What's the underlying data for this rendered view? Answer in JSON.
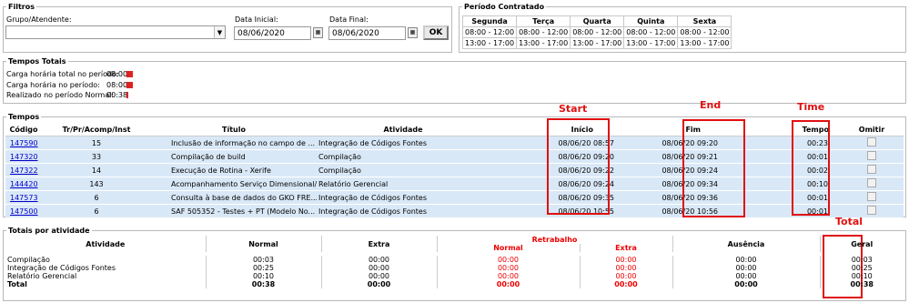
{
  "filtros": {
    "legend": "Filtros",
    "grupo_label": "Grupo/Atendente:",
    "grupo_value": "",
    "data_inicial_label": "Data Inicial:",
    "data_inicial_value": "08/06/2020",
    "data_final_label": "Data Final:",
    "data_final_value": "08/06/2020",
    "ok_label": "OK"
  },
  "periodo": {
    "legend": "Período Contratado",
    "days": [
      "Segunda",
      "Terça",
      "Quarta",
      "Quinta",
      "Sexta"
    ],
    "row1": "08:00 - 12:00",
    "row2": "13:00 - 17:00"
  },
  "tempos_totais": {
    "legend": "Tempos Totais",
    "items": [
      {
        "label": "Carga horária total no período:",
        "value": "08:00"
      },
      {
        "label": "Carga horária no período:",
        "value": "08:00"
      },
      {
        "label": "Realizado no período Normal:",
        "value": "00:38"
      }
    ]
  },
  "tempos": {
    "legend": "Tempos",
    "columns": [
      "Código",
      "Tr/Pr/Acomp/Inst",
      "Título",
      "Atividade",
      "Início",
      "Fim",
      "Tempo",
      "Omitir"
    ],
    "rows": [
      {
        "codigo": "147590",
        "tr": "15",
        "titulo": "Inclusão de informação no campo de ...",
        "atividade": "Integração de Códigos Fontes",
        "inicio": "08/06/20 08:57",
        "fim": "08/06/20 09:20",
        "tempo": "00:23"
      },
      {
        "codigo": "147320",
        "tr": "33",
        "titulo": "Compilação de build",
        "atividade": "Compilação",
        "inicio": "08/06/20 09:20",
        "fim": "08/06/20 09:21",
        "tempo": "00:01"
      },
      {
        "codigo": "147322",
        "tr": "14",
        "titulo": "Execução de Rotina - Xerife",
        "atividade": "Compilação",
        "inicio": "08/06/20 09:22",
        "fim": "08/06/20 09:24",
        "tempo": "00:02"
      },
      {
        "codigo": "144420",
        "tr": "143",
        "titulo": "Acompanhamento Serviço Dimensional/...",
        "atividade": "Relatório Gerencial",
        "inicio": "08/06/20 09:24",
        "fim": "08/06/20 09:34",
        "tempo": "00:10"
      },
      {
        "codigo": "147573",
        "tr": "6",
        "titulo": "Consulta à base de dados do GKO FRE...",
        "atividade": "Integração de Códigos Fontes",
        "inicio": "08/06/20 09:35",
        "fim": "08/06/20 09:36",
        "tempo": "00:01"
      },
      {
        "codigo": "147500",
        "tr": "6",
        "titulo": "SAF 505352 - Testes + PT (Modelo No...",
        "atividade": "Integração de Códigos Fontes",
        "inicio": "08/06/20 10:55",
        "fim": "08/06/20 10:56",
        "tempo": "00:01"
      }
    ]
  },
  "annotations": {
    "start": "Start",
    "end": "End",
    "time": "Time",
    "total": "Total",
    "color": "#e01010"
  },
  "totais": {
    "legend": "Totais por atividade",
    "columns": {
      "atividade": "Atividade",
      "normal": "Normal",
      "extra": "Extra",
      "retrabalho": "Retrabalho",
      "ret_normal": "Normal",
      "ret_extra": "Extra",
      "ausencia": "Ausência",
      "geral": "Geral"
    },
    "rows": [
      {
        "atividade": "Compilação",
        "normal": "00:03",
        "extra": "00:00",
        "rn": "00:00",
        "re": "00:00",
        "ausencia": "00:00",
        "geral": "00:03"
      },
      {
        "atividade": "Integração de Códigos Fontes",
        "normal": "00:25",
        "extra": "00:00",
        "rn": "00:00",
        "re": "00:00",
        "ausencia": "00:00",
        "geral": "00:25"
      },
      {
        "atividade": "Relatório Gerencial",
        "normal": "00:10",
        "extra": "00:00",
        "rn": "00:00",
        "re": "00:00",
        "ausencia": "00:00",
        "geral": "00:10"
      }
    ],
    "total": {
      "atividade": "Total",
      "normal": "00:38",
      "extra": "00:00",
      "rn": "00:00",
      "re": "00:00",
      "ausencia": "00:00",
      "geral": "00:38"
    }
  }
}
